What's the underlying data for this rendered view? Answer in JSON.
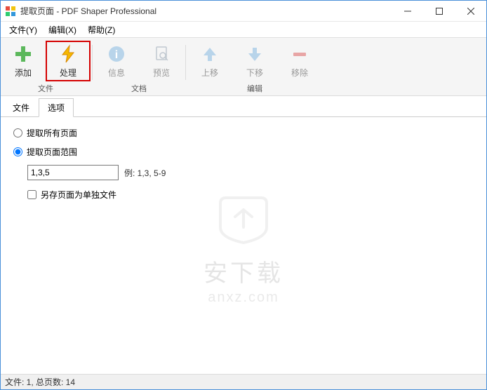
{
  "titlebar": {
    "title": "提取页面 - PDF Shaper Professional"
  },
  "menubar": {
    "file": "文件(Y)",
    "edit": "编辑(X)",
    "help": "帮助(Z)"
  },
  "toolbar": {
    "add": "添加",
    "process": "处理",
    "info": "信息",
    "preview": "预览",
    "moveup": "上移",
    "movedown": "下移",
    "remove": "移除",
    "group_file": "文件",
    "group_doc": "文档",
    "group_edit": "编辑"
  },
  "tabs": {
    "files": "文件",
    "options": "选项"
  },
  "options": {
    "extract_all": "提取所有页面",
    "extract_range": "提取页面范围",
    "range_value": "1,3,5",
    "range_example": "例: 1,3, 5-9",
    "save_separate": "另存页面为单独文件"
  },
  "watermark": {
    "line1": "安下载",
    "line2": "anxz.com"
  },
  "statusbar": {
    "text": "文件: 1, 总页数: 14"
  }
}
